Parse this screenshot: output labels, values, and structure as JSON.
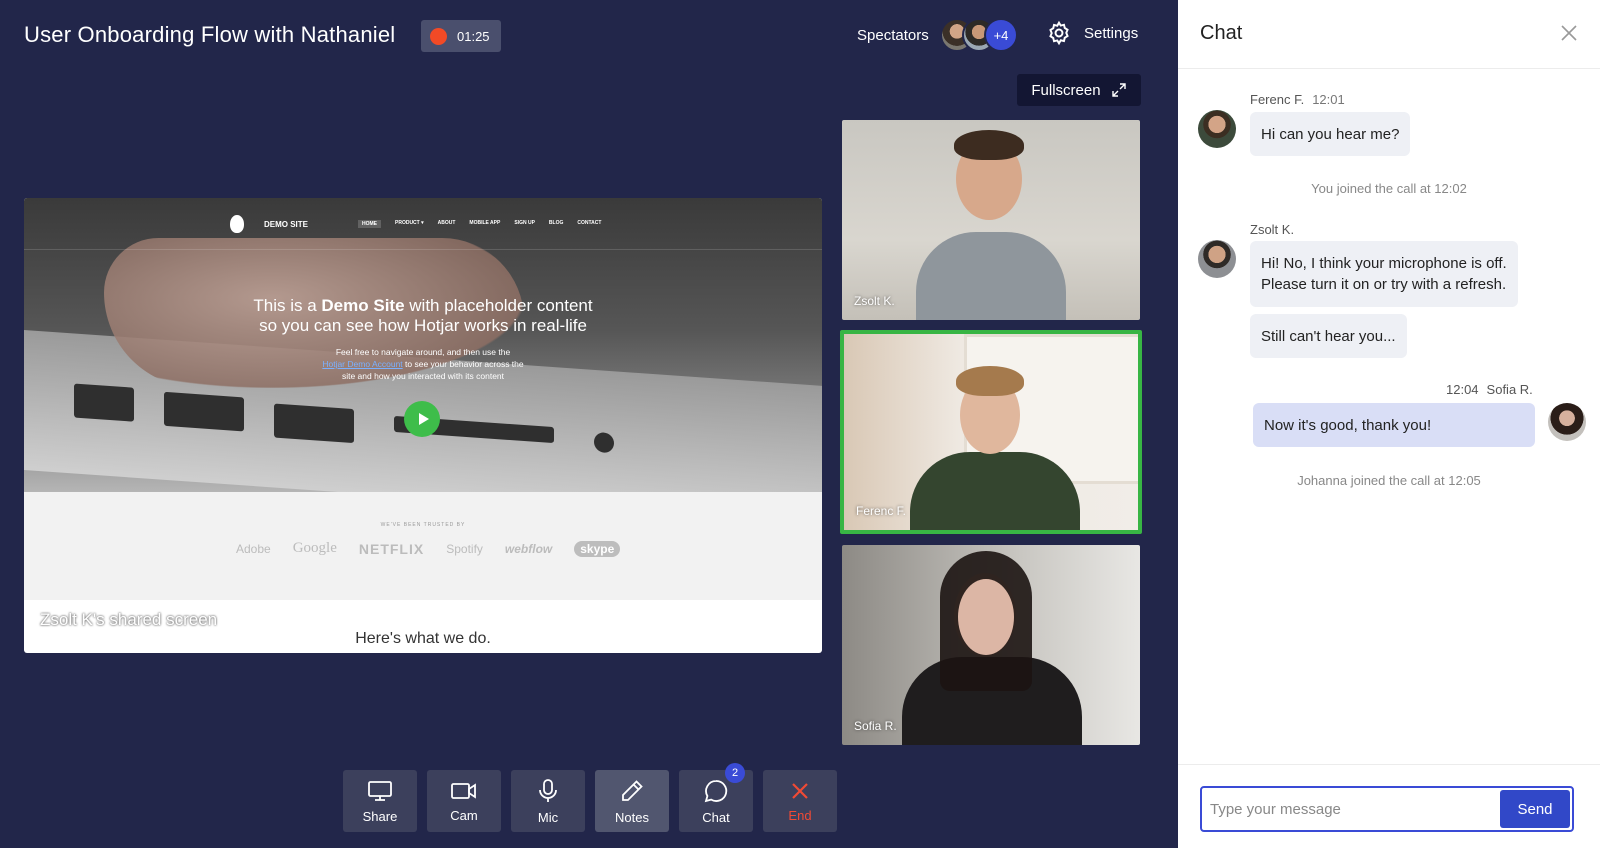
{
  "header": {
    "title": "User Onboarding Flow with Nathaniel",
    "timer": "01:25",
    "spectators_label": "Spectators",
    "spectators_more": "+4",
    "settings_label": "Settings",
    "fullscreen_label": "Fullscreen"
  },
  "shared_screen": {
    "caption": "Zsolt K's shared screen",
    "subtitle": "Here's what we do.",
    "site": {
      "name": "DEMO SITE",
      "menu": [
        "HOME",
        "PRODUCT ▾",
        "ABOUT",
        "MOBILE APP",
        "SIGN UP",
        "BLOG",
        "CONTACT"
      ],
      "headline_pre": "This is a ",
      "headline_bold": "Demo Site",
      "headline_post": " with placeholder content",
      "headline_line2": "so you can see how Hotjar works in real-life",
      "para_line1": "Feel free to navigate around, and then use the",
      "para_link": "Hotjar Demo Account",
      "para_line2_rest": " to see your behavior across the",
      "para_line3": "site and how you interacted with its content",
      "trusted_title": "WE'VE BEEN TRUSTED BY",
      "logos": [
        "Adobe",
        "Google",
        "NETFLIX",
        "Spotify",
        "webflow",
        "skype"
      ]
    }
  },
  "participants": [
    {
      "name": "Zsolt K."
    },
    {
      "name": "Ferenc F."
    },
    {
      "name": "Sofia R."
    }
  ],
  "toolbar": {
    "share": "Share",
    "cam": "Cam",
    "mic": "Mic",
    "notes": "Notes",
    "chat": "Chat",
    "chat_badge": "2",
    "end": "End"
  },
  "chat": {
    "title": "Chat",
    "messages": [
      {
        "author": "Ferenc F.",
        "time": "12:01",
        "text": "Hi can you hear me?"
      },
      {
        "system": "You joined the call at 12:02"
      },
      {
        "author": "Zsolt K.",
        "text_line1": "Hi! No, I think your microphone is off.",
        "text_line2": "Please turn it on or try with a refresh."
      },
      {
        "text": "Still can't hear you..."
      },
      {
        "author": "Sofia R.",
        "time": "12:04",
        "text": "Now it's good, thank you!"
      },
      {
        "system": "Johanna joined the call at 12:05"
      }
    ],
    "input_placeholder": "Type your message",
    "send_label": "Send"
  },
  "colors": {
    "background": "#22264a",
    "accent": "#3a4bd6",
    "recording": "#f24a26",
    "active_speaker": "#38b544",
    "end_call": "#f04a35"
  }
}
